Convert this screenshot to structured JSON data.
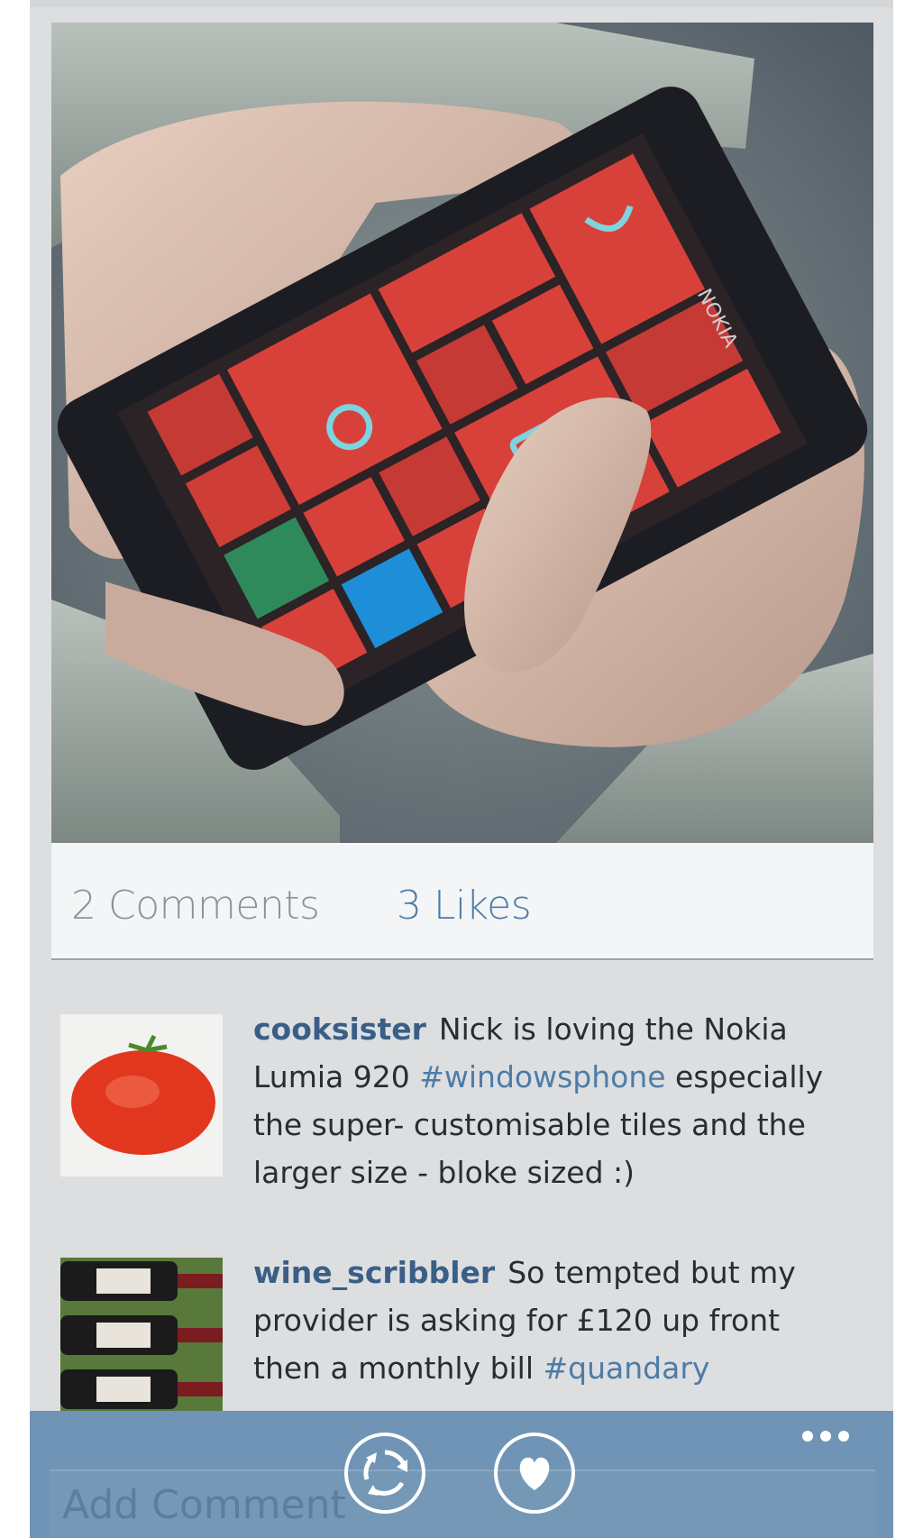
{
  "post": {
    "image_icon": "photo-of-hands-holding-nokia-lumia-phone",
    "brand_label": "NOKIA"
  },
  "stats": {
    "comments": "2 Comments",
    "likes": "3 Likes"
  },
  "comments": [
    {
      "avatar_icon": "tomato-avatar",
      "username": "cooksister",
      "text_a": "Nick is loving the Nokia Lumia 920 ",
      "hashtag": "#windowsphone",
      "text_b": " especially the super- customisable tiles and the larger size - bloke sized :)"
    },
    {
      "avatar_icon": "wine-bottles-avatar",
      "username": "wine_scribbler",
      "text_a": "So tempted but my provider is asking for £120 up front then a monthly bill ",
      "hashtag": "#quandary",
      "text_b": ""
    }
  ],
  "appbar": {
    "placeholder": "Add Comment",
    "refresh_icon": "refresh-icon",
    "like_icon": "heart-icon",
    "more_icon": "more-icon"
  },
  "colors": {
    "accent": "#4d7ca8",
    "username": "#3a5f86",
    "appbar": "#6f94b5",
    "tile_red": "#d8413a"
  }
}
